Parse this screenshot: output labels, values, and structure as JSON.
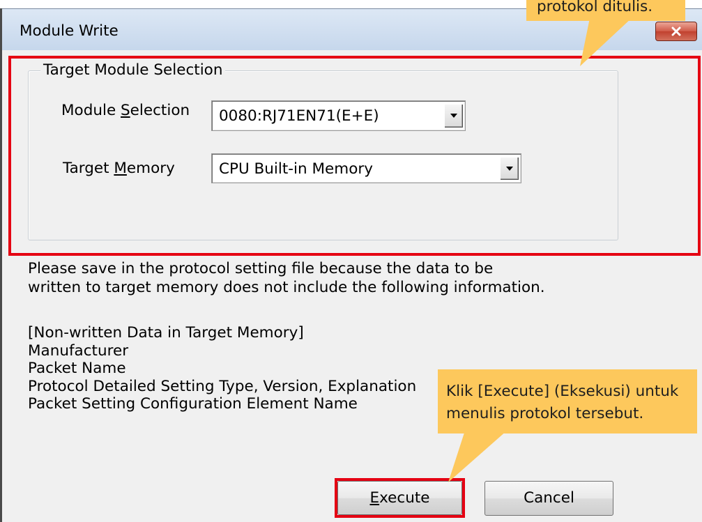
{
  "window": {
    "title": "Module Write"
  },
  "icons": {
    "close": "close-icon",
    "dropdown": "dropdown-arrow-icon"
  },
  "target_module_selection": {
    "title": "Target Module Selection",
    "module_selection": {
      "label_parts": [
        "Module ",
        "S",
        "election"
      ],
      "value": "0080:RJ71EN71(E+E)"
    },
    "target_memory": {
      "label_parts": [
        "Target ",
        "M",
        "emory"
      ],
      "value": "CPU Built-in Memory"
    }
  },
  "message": {
    "lines": [
      "Please save in the protocol setting file because the data to be",
      "written to target memory does not include the following information."
    ]
  },
  "non_written_data": {
    "heading": "[Non-written Data in Target Memory]",
    "items": [
      "Manufacturer",
      "Packet Name",
      "Protocol Detailed Setting Type, Version, Explanation",
      "Packet Setting Configuration Element Name"
    ]
  },
  "buttons": {
    "execute": {
      "label_parts": [
        "E",
        "xecute"
      ]
    },
    "cancel": {
      "label": "Cancel"
    }
  },
  "callouts": {
    "top": {
      "lines": [
        "protokol ditulis."
      ]
    },
    "execute": {
      "lines": [
        "Klik [Execute] (Eksekusi) untuk",
        "menulis protokol tersebut."
      ]
    }
  },
  "colors": {
    "callout": "#fdc85c",
    "highlight": "#e50012",
    "dialog_background": "#f0f0f0",
    "title_bar": "#c6d7ec"
  }
}
